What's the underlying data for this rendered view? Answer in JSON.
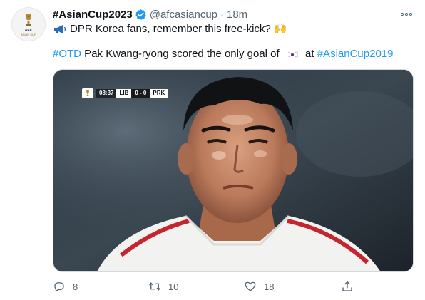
{
  "account": {
    "name": "#AsianCup2023",
    "handle": "@afcasiancup",
    "separator": "·",
    "time": "18m",
    "avatar_text_1": "AFC",
    "avatar_text_2": "ASIAN CUP"
  },
  "tweet": {
    "line1_text": "DPR Korea fans, remember this free-kick?",
    "line1_emoji": "🙌",
    "line2_hashtag": "#OTD",
    "line2_text": " Pak Kwang-ryong scored the only goal of ",
    "line2_mid": " at ",
    "line2_hashtag2": "#AsianCup2019"
  },
  "media": {
    "scorebug": {
      "clock": "08:37",
      "home": "LIB",
      "score": "0 - 0",
      "away": "PRK"
    }
  },
  "actions": {
    "reply_count": "8",
    "retweet_count": "10",
    "like_count": "18"
  },
  "icons": {
    "verified": "verified-badge-icon",
    "more": "more-icon",
    "megaphone": "megaphone-icon",
    "reply": "reply-icon",
    "retweet": "retweet-icon",
    "like": "like-icon",
    "share": "share-icon"
  },
  "colors": {
    "link": "#1d9bf0",
    "secondary_text": "#536471",
    "verified": "#1d9bf0"
  }
}
